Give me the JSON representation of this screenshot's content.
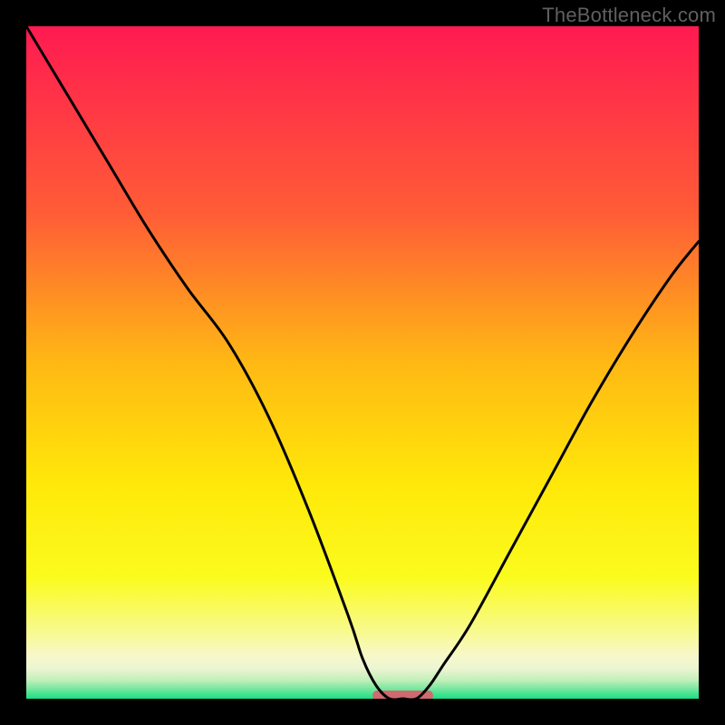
{
  "watermark": "TheBottleneck.com",
  "chart_data": {
    "type": "line",
    "title": "",
    "xlabel": "",
    "ylabel": "",
    "xlim": [
      0,
      100
    ],
    "ylim": [
      0,
      100
    ],
    "grid": false,
    "legend": false,
    "annotations": [],
    "series": [
      {
        "name": "curve",
        "x": [
          0,
          6,
          12,
          18,
          24,
          30,
          36,
          42,
          48,
          50,
          52,
          54,
          56,
          58,
          60,
          62,
          66,
          72,
          78,
          84,
          90,
          96,
          100
        ],
        "y": [
          100,
          90,
          80,
          70,
          61,
          53,
          42,
          28,
          12,
          6,
          2,
          0,
          0,
          0,
          2,
          5,
          11,
          22,
          33,
          44,
          54,
          63,
          68
        ]
      }
    ],
    "marker": {
      "name": "optimum-marker",
      "x_center": 56,
      "width": 9,
      "y": 0,
      "color": "#cf6a6f"
    },
    "background_gradient": {
      "stops": [
        {
          "offset": 0.0,
          "color": "#ff1a51"
        },
        {
          "offset": 0.28,
          "color": "#ff5d36"
        },
        {
          "offset": 0.5,
          "color": "#ffb814"
        },
        {
          "offset": 0.68,
          "color": "#ffe809"
        },
        {
          "offset": 0.82,
          "color": "#fbfb1e"
        },
        {
          "offset": 0.9,
          "color": "#f8fa8e"
        },
        {
          "offset": 0.935,
          "color": "#f7f8c8"
        },
        {
          "offset": 0.955,
          "color": "#ecf5d2"
        },
        {
          "offset": 0.972,
          "color": "#c4efba"
        },
        {
          "offset": 0.985,
          "color": "#79e79f"
        },
        {
          "offset": 1.0,
          "color": "#18e084"
        }
      ]
    }
  }
}
